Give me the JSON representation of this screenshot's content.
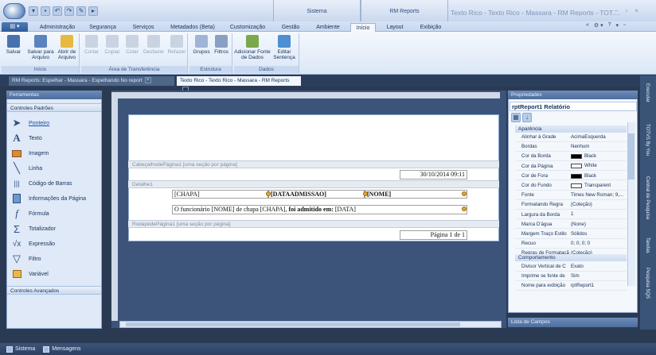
{
  "titlebar": {
    "window_title": "Texto Rico - Texto Rico - Massara - RM Reports - TOT....",
    "context_groups": [
      "Sistema",
      "RM Reports"
    ],
    "controls": [
      "–",
      "▫",
      "×"
    ]
  },
  "tabs": [
    "Administração",
    "Segurança",
    "Serviços",
    "Metadados (Beta)",
    "Customização",
    "Gestão",
    "Ambiente",
    "Início",
    "Layout",
    "Exibição"
  ],
  "tabs_active": "Início",
  "tab_right": [
    "«",
    "⚙ ▾",
    "?",
    "▾",
    "▫"
  ],
  "ribbon": {
    "groups": [
      {
        "label": "Início",
        "buttons": [
          "Salvar",
          "Salvar para Arquivo",
          "Abrir de Arquivo"
        ]
      },
      {
        "label": "Área de Transferência",
        "buttons": [
          "Cortar",
          "Copiar",
          "Colar",
          "Desfazer",
          "Refazer"
        ]
      },
      {
        "label": "Estrutura",
        "buttons": [
          "Grupos",
          "Filtros"
        ]
      },
      {
        "label": "Dados",
        "buttons": [
          "Adicionar Fonte de Dados",
          "Editar Sentença"
        ]
      }
    ]
  },
  "doc_tabs": [
    "RM Reports: Espelhar - Massara - Espelhando No report",
    "Texto Rico - Texto Rico - Massara - RM Reports"
  ],
  "toolbox": {
    "title": "Ferramentas",
    "section1": "Controles Padrões",
    "items": [
      "Ponteiro",
      "Texto",
      "Imagem",
      "Linha",
      "Código de Barras",
      "Informações da Página",
      "Fórmula",
      "Totalizador",
      "Expressão",
      "Filtro",
      "Variável"
    ],
    "section2": "Controles Avançados"
  },
  "designer": {
    "bands": [
      "CabeçalhodePágina1 [uma seção por página]",
      "Detalhe1",
      "RodapédePágina1 [uma seção por página]"
    ],
    "date_field": "30/10/2014 09:11",
    "fields": [
      "[CHAPA]",
      "[DATAADMISSAO]",
      "[NOME]"
    ],
    "sentence": "O funcionário  [NOME] de chapa [CHAPA], foi admitido em: [DATA]",
    "sentence_bold": "foi admitido em:",
    "page_field": "Página 1 de 1"
  },
  "properties": {
    "title": "Propriedades",
    "object": "rptReport1  Relatório",
    "cat1": "Aparência",
    "rows1": [
      {
        "name": "Alinhar à Grade",
        "value": "AcimaEsquerda"
      },
      {
        "name": "Bordas",
        "value": "Nenhum"
      },
      {
        "name": "Cor da Borda",
        "value": "Black",
        "swatch": "#000000"
      },
      {
        "name": "Cor da Página",
        "value": "White",
        "swatch": "#ffffff"
      },
      {
        "name": "Cor de Fora",
        "value": "Black",
        "swatch": "#000000"
      },
      {
        "name": "Cor do Fundo",
        "value": "Transparent",
        "swatch": "#ffffff"
      },
      {
        "name": "Fonte",
        "value": "Times New Roman; 9,..."
      },
      {
        "name": "Formatando Regra",
        "value": "(Coleção)"
      },
      {
        "name": "Largura da Borda",
        "value": "1"
      },
      {
        "name": "Marca D'água",
        "value": "(None)"
      },
      {
        "name": "Margem Traço Estilo",
        "value": "Sólidos"
      },
      {
        "name": "Recuo",
        "value": "0; 0; 0; 0"
      },
      {
        "name": "Regras de Formatação",
        "value": "(Coleção)"
      }
    ],
    "cat2": "Comportamento",
    "rows2": [
      {
        "name": "Divisor Vertical de C",
        "value": "Exato"
      },
      {
        "name": "Imprime se fonte de",
        "value": "Sim"
      },
      {
        "name": "Nome para exibição",
        "value": "rptReport1"
      }
    ],
    "field_list": "Lista de Campos"
  },
  "vertical_tabs": [
    "Executar",
    "TOTVS By You",
    "Central de Pesquisa",
    "Tarefas",
    "Pesquisa SQS"
  ],
  "status": [
    "Sistema",
    "Mensagens"
  ]
}
